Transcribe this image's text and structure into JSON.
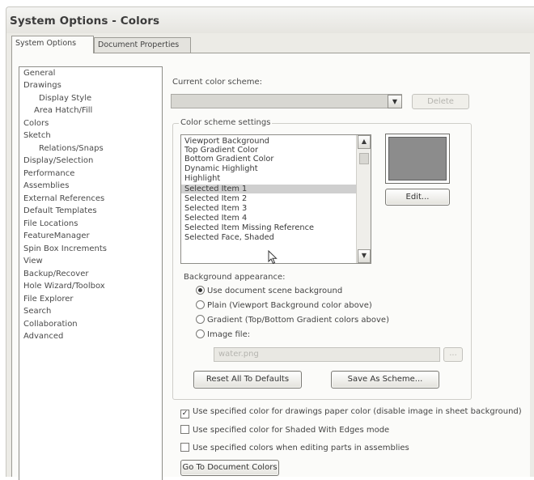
{
  "window": {
    "title": "System Options - Colors"
  },
  "tabs": [
    {
      "label": "System Options",
      "active": true
    },
    {
      "label": "Document Properties",
      "active": false
    }
  ],
  "nav": {
    "items": [
      {
        "label": "General",
        "indent": false
      },
      {
        "label": "Drawings",
        "indent": false
      },
      {
        "label": "Display Style",
        "indent": true
      },
      {
        "label": "Area Hatch/Fill",
        "indent": true
      },
      {
        "label": "Colors",
        "indent": false,
        "selected": true
      },
      {
        "label": "Sketch",
        "indent": false
      },
      {
        "label": "Relations/Snaps",
        "indent": true
      },
      {
        "label": "Display/Selection",
        "indent": false
      },
      {
        "label": "Performance",
        "indent": false
      },
      {
        "label": "Assemblies",
        "indent": false
      },
      {
        "label": "External References",
        "indent": false
      },
      {
        "label": "Default Templates",
        "indent": false
      },
      {
        "label": "File Locations",
        "indent": false
      },
      {
        "label": "FeatureManager",
        "indent": false
      },
      {
        "label": "Spin Box Increments",
        "indent": false
      },
      {
        "label": "View",
        "indent": false
      },
      {
        "label": "Backup/Recover",
        "indent": false
      },
      {
        "label": "Hole Wizard/Toolbox",
        "indent": false
      },
      {
        "label": "File Explorer",
        "indent": false
      },
      {
        "label": "Search",
        "indent": false
      },
      {
        "label": "Collaboration",
        "indent": false
      },
      {
        "label": "Advanced",
        "indent": false
      }
    ]
  },
  "scheme": {
    "label": "Current color scheme:",
    "value": "",
    "delete_label": "Delete"
  },
  "settings": {
    "group_label": "Color scheme settings",
    "items": [
      "Viewport Background",
      "Top Gradient Color",
      "Bottom Gradient Color",
      "Dynamic Highlight",
      "Highlight",
      "Selected Item 1",
      "Selected Item 2",
      "Selected Item 3",
      "Selected Item 4",
      "Selected Item Missing Reference",
      "Selected Face, Shaded"
    ],
    "selected_index": 5,
    "swatch_color": "#8c8c8c",
    "edit_label": "Edit..."
  },
  "background": {
    "label": "Background appearance:",
    "options": [
      {
        "label": "Use document scene background",
        "selected": true
      },
      {
        "label": "Plain (Viewport Background color above)",
        "selected": false
      },
      {
        "label": "Gradient (Top/Bottom Gradient colors above)",
        "selected": false
      },
      {
        "label": "Image file:",
        "selected": false
      }
    ],
    "image_file": "water.png",
    "browse_label": "...",
    "reset_label": "Reset All To Defaults",
    "save_label": "Save As Scheme..."
  },
  "checks": [
    {
      "label": "Use specified color for drawings paper color (disable image in sheet background)",
      "checked": true
    },
    {
      "label": "Use specified color for Shaded With Edges mode",
      "checked": false
    },
    {
      "label": "Use specified colors when editing parts in assemblies",
      "checked": false
    }
  ],
  "go_to_label": "Go To Document Colors"
}
